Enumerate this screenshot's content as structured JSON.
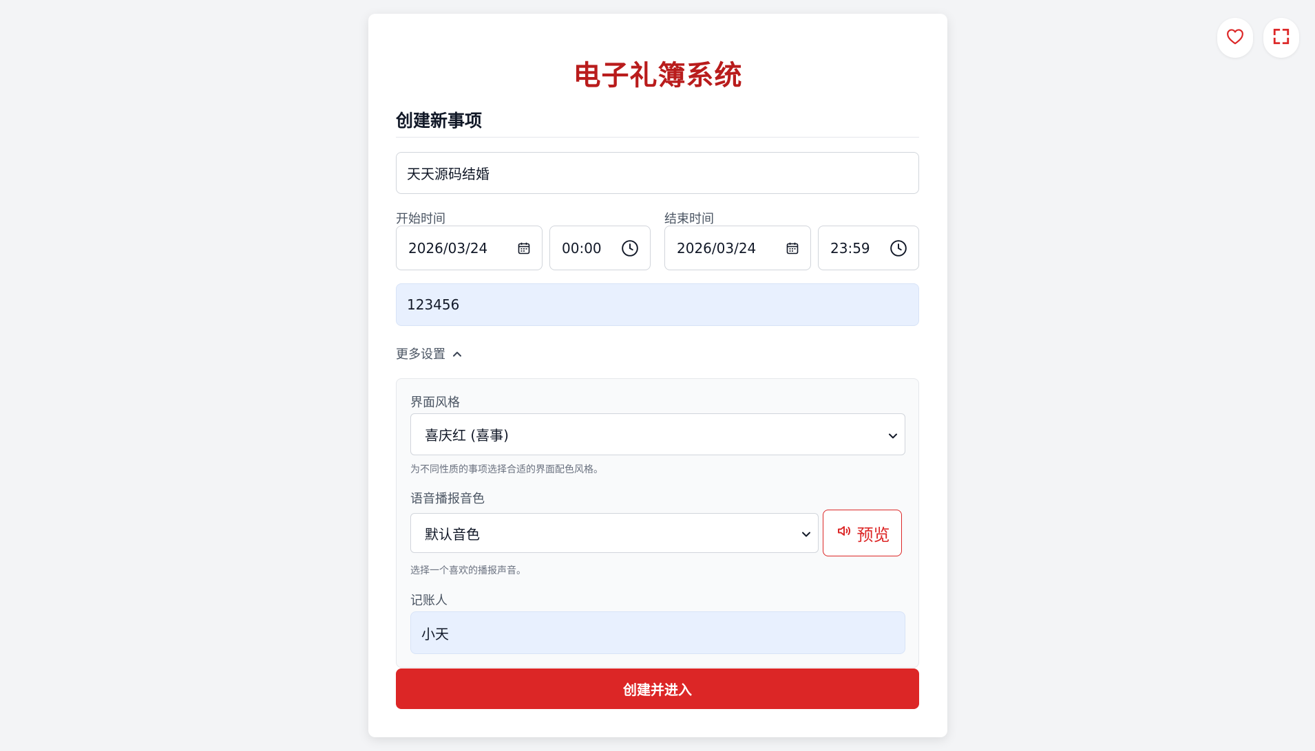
{
  "app": {
    "title": "电子礼簿系统"
  },
  "form": {
    "section_title": "创建新事项",
    "event_name": {
      "value": "天天源码结婚"
    },
    "start": {
      "label": "开始时间",
      "date": "2026/03/24",
      "time": "00:00"
    },
    "end": {
      "label": "结束时间",
      "date": "2026/03/24",
      "time": "23:59"
    },
    "password": {
      "value": "123456"
    },
    "more_settings": {
      "label": "更多设置",
      "icon": "chevron-up-icon",
      "expanded": true
    },
    "theme": {
      "label": "界面风格",
      "selected": "喜庆红 (喜事)",
      "hint": "为不同性质的事项选择合适的界面配色风格。"
    },
    "voice": {
      "label": "语音播报音色",
      "selected": "默认音色",
      "hint": "选择一个喜欢的播报声音。",
      "preview_label": "预览",
      "preview_icon": "speaker-icon"
    },
    "recorder": {
      "label": "记账人",
      "value": "小天"
    },
    "submit_label": "创建并进入"
  },
  "corner_actions": {
    "favorite_icon": "heart-icon",
    "fullscreen_icon": "fullscreen-icon"
  },
  "colors": {
    "accent": "#dc2626",
    "title": "#b91c1c",
    "autofill_bg": "#e8f0fe",
    "page_bg": "#f3f4f6"
  }
}
